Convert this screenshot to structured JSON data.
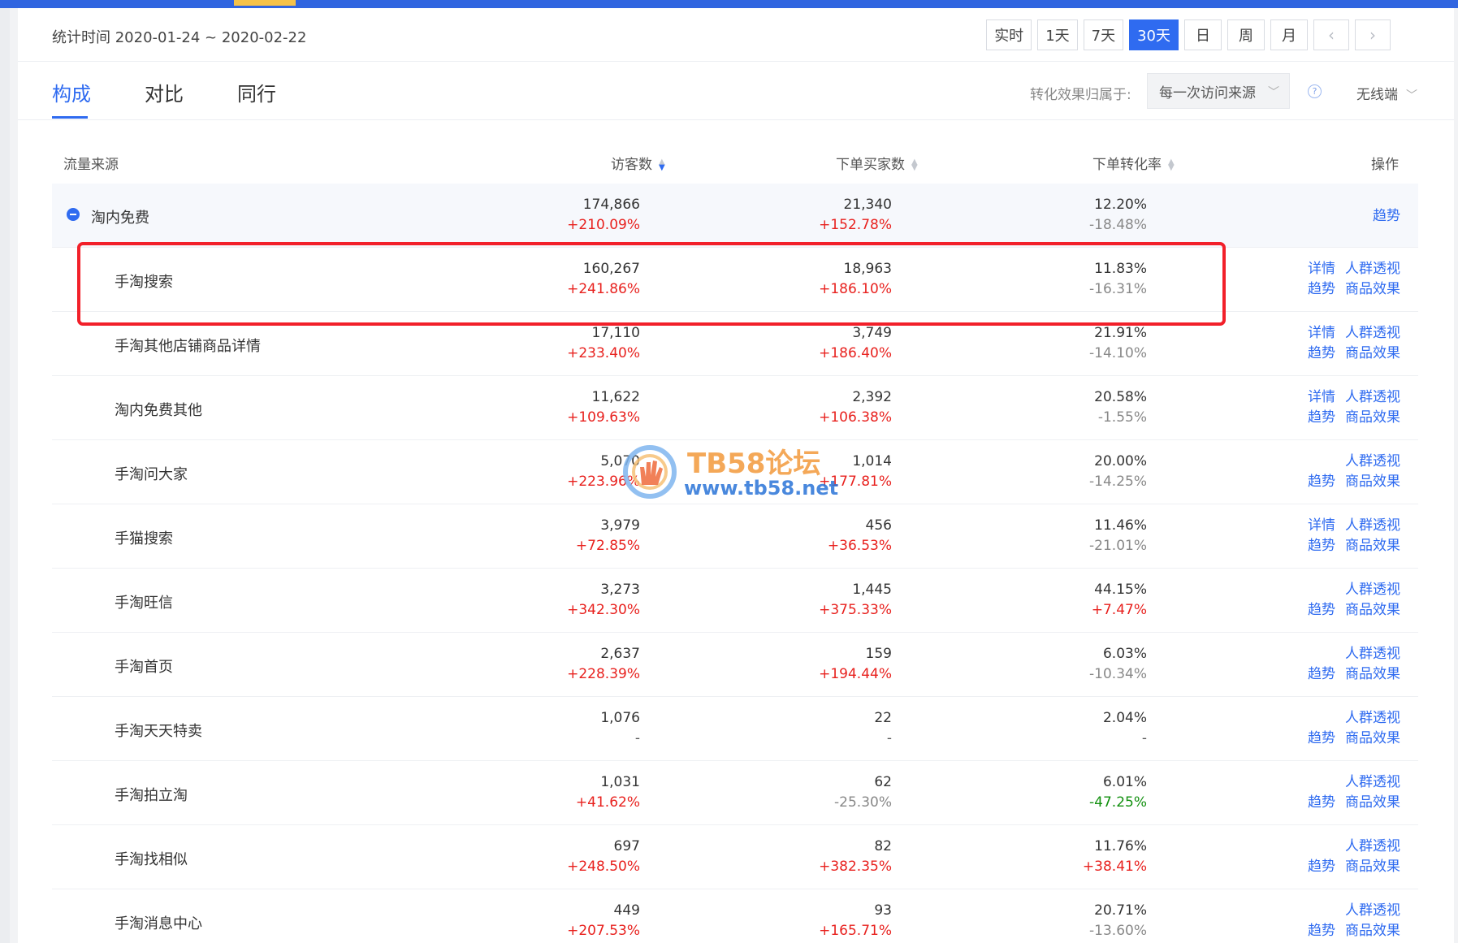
{
  "header": {
    "stat_time": "统计时间 2020-01-24 ~ 2020-02-22",
    "range_buttons": [
      "实时",
      "1天",
      "7天",
      "30天",
      "日",
      "周",
      "月"
    ],
    "active_range": "30天",
    "prev_icon": "chevron-left-icon",
    "next_icon": "chevron-right-icon"
  },
  "tabs": [
    {
      "label": "构成",
      "active": true
    },
    {
      "label": "对比",
      "active": false
    },
    {
      "label": "同行",
      "active": false
    }
  ],
  "attribution": {
    "label": "转化效果归属于:",
    "selected": "每一次访问来源",
    "device": "无线端"
  },
  "table": {
    "headers": {
      "source": "流量来源",
      "visitors": "访客数",
      "buyers": "下单买家数",
      "rate": "下单转化率",
      "ops": "操作"
    },
    "ops_labels": {
      "detail": "详情",
      "crowd": "人群透视",
      "trend": "趋势",
      "product": "商品效果"
    },
    "group": {
      "name": "淘内免费",
      "visitors": "174,866",
      "visitors_chg": "+210.09%",
      "buyers": "21,340",
      "buyers_chg": "+152.78%",
      "rate": "12.20%",
      "rate_chg": "-18.48%",
      "op": "趋势"
    },
    "rows": [
      {
        "name": "手淘搜索",
        "visitors": "160,267",
        "visitors_chg": "+241.86%",
        "buyers": "18,963",
        "buyers_chg": "+186.10%",
        "rate": "11.83%",
        "rate_chg": "-16.31%",
        "has_detail": true
      },
      {
        "name": "手淘其他店铺商品详情",
        "visitors": "17,110",
        "visitors_chg": "+233.40%",
        "buyers": "3,749",
        "buyers_chg": "+186.40%",
        "rate": "21.91%",
        "rate_chg": "-14.10%",
        "has_detail": true
      },
      {
        "name": "淘内免费其他",
        "visitors": "11,622",
        "visitors_chg": "+109.63%",
        "buyers": "2,392",
        "buyers_chg": "+106.38%",
        "rate": "20.58%",
        "rate_chg": "-1.55%",
        "has_detail": true
      },
      {
        "name": "手淘问大家",
        "visitors": "5,070",
        "visitors_chg": "+223.96%",
        "buyers": "1,014",
        "buyers_chg": "+177.81%",
        "rate": "20.00%",
        "rate_chg": "-14.25%",
        "has_detail": false
      },
      {
        "name": "手猫搜索",
        "visitors": "3,979",
        "visitors_chg": "+72.85%",
        "buyers": "456",
        "buyers_chg": "+36.53%",
        "rate": "11.46%",
        "rate_chg": "-21.01%",
        "has_detail": true
      },
      {
        "name": "手淘旺信",
        "visitors": "3,273",
        "visitors_chg": "+342.30%",
        "buyers": "1,445",
        "buyers_chg": "+375.33%",
        "rate": "44.15%",
        "rate_chg": "+7.47%",
        "has_detail": false
      },
      {
        "name": "手淘首页",
        "visitors": "2,637",
        "visitors_chg": "+228.39%",
        "buyers": "159",
        "buyers_chg": "+194.44%",
        "rate": "6.03%",
        "rate_chg": "-10.34%",
        "has_detail": false
      },
      {
        "name": "手淘天天特卖",
        "visitors": "1,076",
        "visitors_chg": "-",
        "buyers": "22",
        "buyers_chg": "-",
        "rate": "2.04%",
        "rate_chg": "-",
        "has_detail": false
      },
      {
        "name": "手淘拍立淘",
        "visitors": "1,031",
        "visitors_chg": "+41.62%",
        "buyers": "62",
        "buyers_chg": "-25.30%",
        "rate": "6.01%",
        "rate_chg": "-47.25%",
        "has_detail": false
      },
      {
        "name": "手淘找相似",
        "visitors": "697",
        "visitors_chg": "+248.50%",
        "buyers": "82",
        "buyers_chg": "+382.35%",
        "rate": "11.76%",
        "rate_chg": "+38.41%",
        "has_detail": false
      },
      {
        "name": "手淘消息中心",
        "visitors": "449",
        "visitors_chg": "+207.53%",
        "buyers": "93",
        "buyers_chg": "+165.71%",
        "rate": "20.71%",
        "rate_chg": "-13.60%",
        "has_detail": false
      }
    ]
  },
  "watermark": {
    "title": "TB58论坛",
    "url": "www.tb58.net"
  },
  "colors": {
    "accent": "#2f6bf0",
    "increase": "#e8211e",
    "decrease": "#888888",
    "strong_decrease": "#12900f",
    "highlight": "#f2202a"
  }
}
